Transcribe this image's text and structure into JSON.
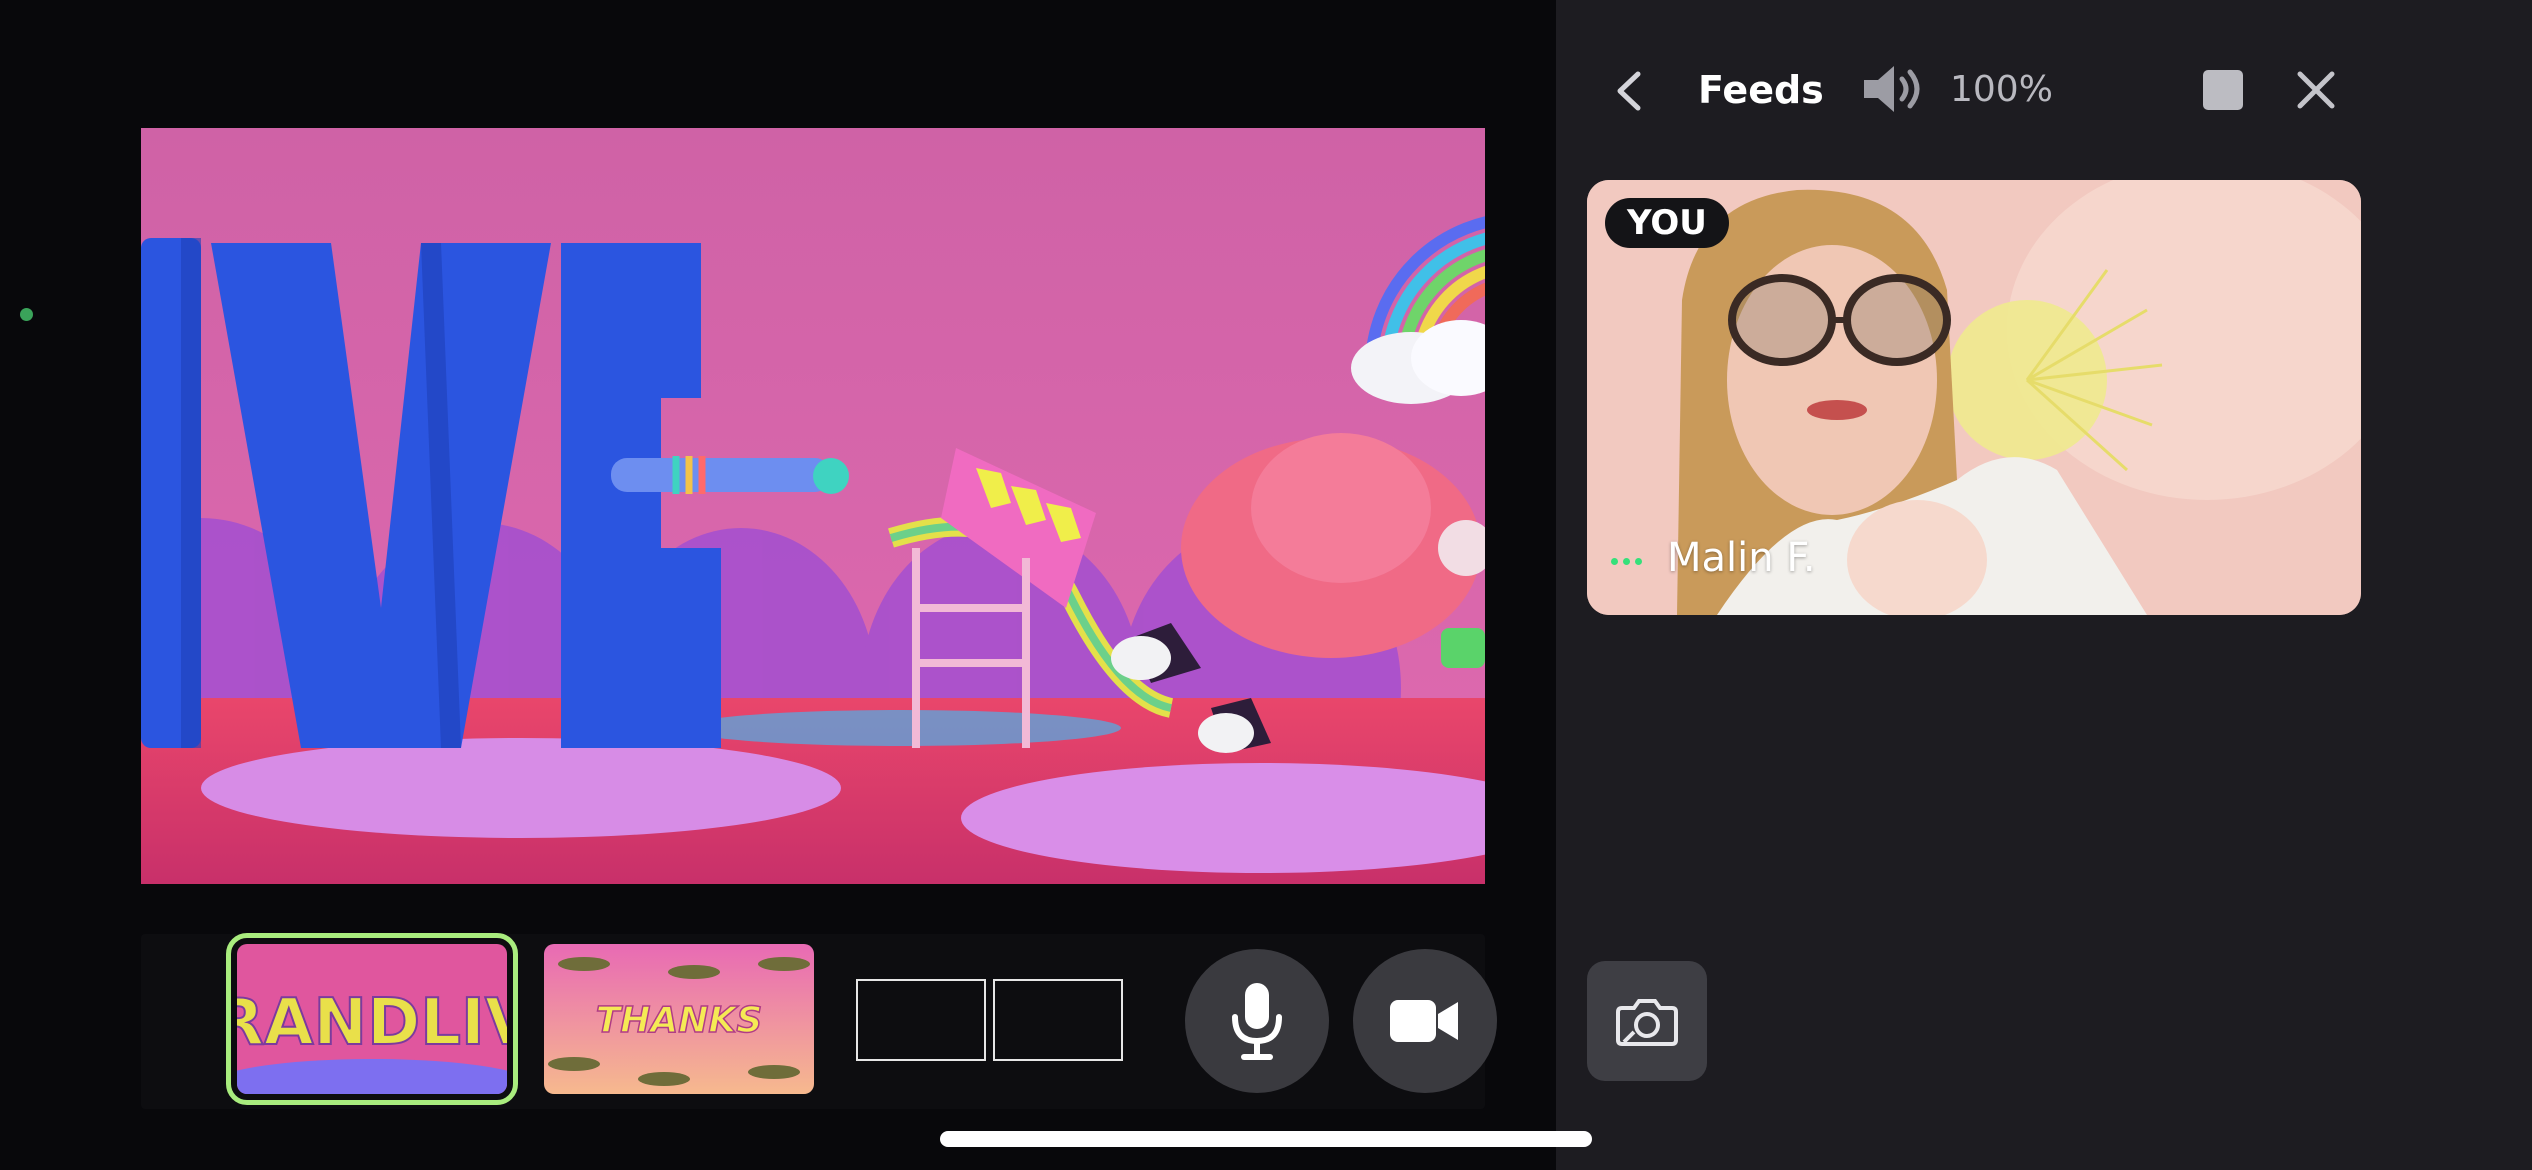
{
  "panel": {
    "title": "Feeds",
    "volume_percent": "100%",
    "icons": {
      "back": "chevron-left-icon",
      "volume": "speaker-icon",
      "stop": "stop-square-icon",
      "close": "close-icon",
      "snapshot": "camera-switch-icon"
    }
  },
  "feed": {
    "badge": "YOU",
    "participant_name": "Malin F."
  },
  "scenes": [
    {
      "label": "BRANDLIVE",
      "selected": true
    },
    {
      "label": "THANKS",
      "selected": false
    }
  ],
  "stage": {
    "text": "LIVE"
  },
  "controls": {
    "mic": "microphone-icon",
    "camera": "video-camera-icon",
    "layout": "two-box-layout-icon"
  },
  "colors": {
    "selected_outline": "#a9ec7e",
    "status_dot": "#35e07a",
    "panel_bg": "#1d1c21"
  }
}
